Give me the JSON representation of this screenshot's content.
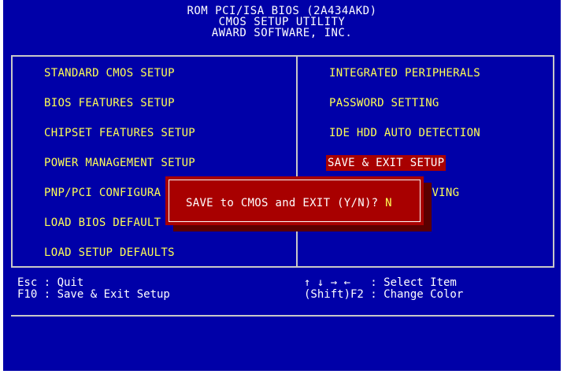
{
  "header": {
    "line1": "ROM PCI/ISA BIOS (2A434AKD)",
    "line2": "CMOS SETUP UTILITY",
    "line3": "AWARD SOFTWARE, INC."
  },
  "menu": {
    "left": [
      "STANDARD CMOS SETUP",
      "BIOS FEATURES SETUP",
      "CHIPSET FEATURES SETUP",
      "POWER MANAGEMENT SETUP",
      "PNP/PCI CONFIGURA",
      "LOAD BIOS DEFAULT",
      "LOAD SETUP DEFAULTS"
    ],
    "right": [
      "INTEGRATED PERIPHERALS",
      "PASSWORD SETTING",
      "IDE HDD AUTO DETECTION",
      "SAVE & EXIT SETUP",
      "SAVING"
    ],
    "selected": "SAVE & EXIT SETUP"
  },
  "dialog": {
    "prompt": "SAVE to CMOS and EXIT (Y/N)? ",
    "value": "N"
  },
  "help": {
    "left_line1": "Esc : Quit",
    "left_line2": "F10 : Save & Exit Setup",
    "right_line1": "↑ ↓ → ←   : Select Item",
    "right_line2": "(Shift)F2 : Change Color"
  },
  "colors": {
    "background": "#0000a8",
    "menu_text": "#ffff54",
    "highlight": "#a80000",
    "text": "#ffffff",
    "border": "#c8c8c8"
  }
}
